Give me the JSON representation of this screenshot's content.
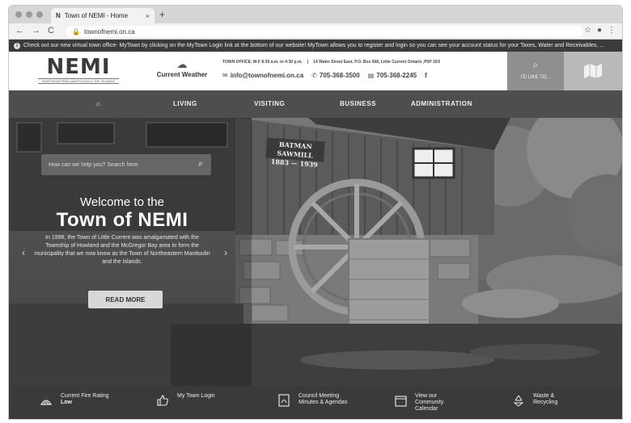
{
  "browser": {
    "tab_title": "Town of NEMI - Home",
    "tab_favicon": "N",
    "new_tab": "+",
    "url": "townofnemi.on.ca"
  },
  "notice": "Check out our new virtual town office- MyTown by clicking on the MyTown Login link at the bottom of our website! MyTown allows you to register and login so you can see your account status for your Taxes, Water and Receivables, ...",
  "header": {
    "logo_text": "NEMI",
    "logo_sub": "NORTHEASTERN MANITOULIN & THE ISLANDS",
    "weather_label": "Current Weather",
    "office_hours": "TOWN OFFICE: M-F 8:30 a.m. to 4:30 p.m.",
    "address": "14 Water Street East, P.O. Box 608, Little Current Ontario ,P0P 1K0",
    "email": "info@townofnemi.on.ca",
    "phone": "705-368-3500",
    "fax": "705-368-2245",
    "facebook": "f",
    "todo_label": "I'D LIKE TO..."
  },
  "nav": {
    "home_icon": "home-icon",
    "items": [
      "LIVING",
      "VISITING",
      "BUSINESS",
      "ADMINISTRATION"
    ]
  },
  "hero": {
    "search_placeholder": "How can we help you? Search here",
    "welcome": "Welcome to the",
    "town": "Town of NEMI",
    "blurb": "In 1998, the Town of Little Current was amalgamated with the Township of Howland and the McGregor Bay area to form the municipality that we now know as the Town of Northeastern Manitoulin and the Islands.",
    "read_more": "READ MORE",
    "sign_line1": "BATMAN SAWMILL",
    "sign_line2": "1883 — 1939"
  },
  "quick_links": [
    {
      "icon": "fire-icon",
      "line1": "Current Fire Rating",
      "line2": "Low"
    },
    {
      "icon": "thumbs-up-icon",
      "line1": "My Town Login",
      "line2": ""
    },
    {
      "icon": "document-icon",
      "line1": "Council Meeting",
      "line2": "Minutes & Agendas"
    },
    {
      "icon": "calendar-icon",
      "line1": "View our",
      "line2": "Community",
      "line3": "Calendar"
    },
    {
      "icon": "recycle-icon",
      "line1": "Waste &",
      "line2": "Recycling"
    }
  ]
}
